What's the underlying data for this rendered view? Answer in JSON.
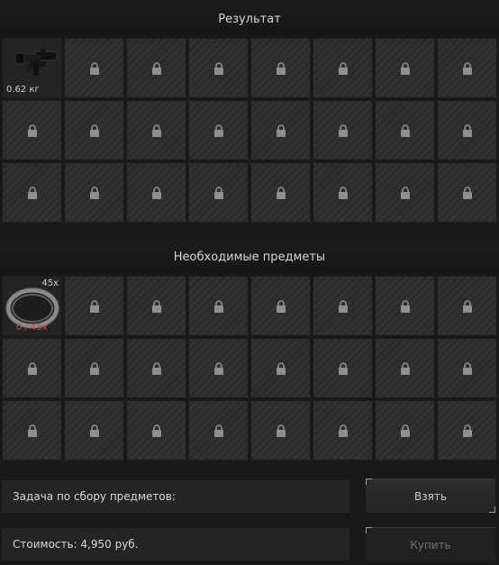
{
  "result_section": {
    "title": "Результат",
    "item": {
      "name": "scope",
      "weight": "0.62 кг"
    },
    "locked_slots": 23
  },
  "required_section": {
    "title": "Необходимые предметы",
    "item": {
      "name": "ring",
      "count": "45x",
      "need": "0 / 45x",
      "need_color": "#e0453f"
    },
    "locked_slots": 23
  },
  "task": {
    "label": "Задача по сбору предметов:"
  },
  "cost": {
    "label": "Стоимость: 4,950 руб."
  },
  "buttons": {
    "take": "Взять",
    "buy": "Купить"
  },
  "icons": {
    "lock": "lock-icon"
  }
}
